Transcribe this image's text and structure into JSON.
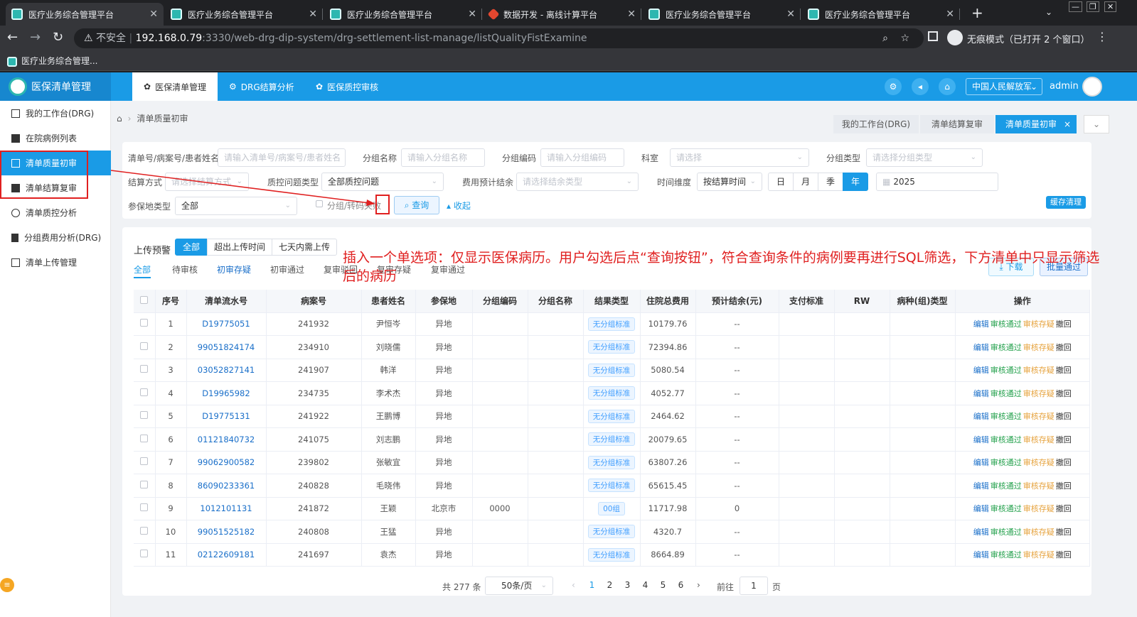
{
  "browser": {
    "tabs": [
      {
        "title": "医疗业务综合管理平台"
      },
      {
        "title": "医疗业务综合管理平台"
      },
      {
        "title": "医疗业务综合管理平台"
      },
      {
        "title": "数据开发 - 离线计算平台"
      },
      {
        "title": "医疗业务综合管理平台"
      },
      {
        "title": "医疗业务综合管理平台"
      }
    ],
    "new_tab": "+",
    "security": "不安全",
    "url_host": "192.168.0.79",
    "url_rest": ":3330/web-drg-dip-system/drg-settlement-list-manage/listQualityFistExamine",
    "incognito": "无痕模式（已打开 2 个窗口）",
    "bookmark": "医疗业务综合管理...",
    "window_controls": [
      "—",
      "❐",
      "✕"
    ]
  },
  "app": {
    "brand": "医保清单管理",
    "top_nav": [
      {
        "label": "医保清单管理"
      },
      {
        "label": "DRG结算分析"
      },
      {
        "label": "医保质控审核"
      }
    ],
    "hospital": "中国人民解放军",
    "user": "admin",
    "sidebar": [
      {
        "label": "我的工作台(DRG)"
      },
      {
        "label": "在院病例列表"
      },
      {
        "label": "清单质量初审"
      },
      {
        "label": "清单结算复审"
      },
      {
        "label": "清单质控分析"
      },
      {
        "label": "分组费用分析(DRG)"
      },
      {
        "label": "清单上传管理"
      }
    ],
    "breadcrumb": "清单质量初审",
    "page_tabs": [
      {
        "label": "我的工作台(DRG)"
      },
      {
        "label": "清单结算复审"
      },
      {
        "label": "清单质量初审"
      }
    ]
  },
  "filters": {
    "search_label": "清单号/病案号/患者姓名",
    "search_placeholder": "请输入清单号/病案号/患者姓名",
    "group_name_label": "分组名称",
    "group_name_placeholder": "请输入分组名称",
    "group_code_label": "分组编码",
    "group_code_placeholder": "请输入分组编码",
    "dept_label": "科室",
    "dept_placeholder": "请选择",
    "group_type_label": "分组类型",
    "group_type_placeholder": "请选择分组类型",
    "settle_label": "结算方式",
    "settle_placeholder": "请选择结算方式",
    "qc_type_label": "质控问题类型",
    "qc_type_value": "全部质控问题",
    "fee_label": "费用预计结余",
    "fee_placeholder": "请选择结余类型",
    "time_label": "时间维度",
    "time_value": "按结算时间",
    "period_buttons": [
      "日",
      "月",
      "季",
      "年"
    ],
    "year_value": "2025",
    "insured_label": "参保地类型",
    "insured_value": "全部",
    "transfer_label": "分组/转码失败",
    "query_button": "查询",
    "collapse_button": "收起",
    "cache_button": "缓存清理"
  },
  "annotation": "插入一个单选项：仅显示医保病历。用户勾选后点“查询按钮”，符合查询条件的病例要再进行SQL筛选，下方清单中只显示筛选后的病历",
  "list": {
    "warning_label": "上传预警",
    "warning_tabs": [
      "全部",
      "超出上传时间",
      "七天内需上传"
    ],
    "status_tabs": [
      "全部",
      "待审核",
      "初审存疑",
      "初审通过",
      "复审驳回",
      "复审存疑",
      "复审通过"
    ],
    "download_button": "下载",
    "batch_button": "批量通过",
    "columns": [
      "序号",
      "清单流水号",
      "病案号",
      "患者姓名",
      "参保地",
      "分组编码",
      "分组名称",
      "结果类型",
      "住院总费用",
      "预计结余(元)",
      "支付标准",
      "RW",
      "病种(组)类型",
      "操作"
    ],
    "actions": [
      "编辑",
      "审核通过",
      "审核存疑",
      "撤回"
    ],
    "rows": [
      {
        "no": "1",
        "serial": "D19775051",
        "case_no": "241932",
        "name": "尹恒岑",
        "insured": "异地",
        "code": "",
        "group": "",
        "result": "无分组标准",
        "cost": "10179.76",
        "balance": "--"
      },
      {
        "no": "2",
        "serial": "99051824174",
        "case_no": "234910",
        "name": "刘晓儒",
        "insured": "异地",
        "code": "",
        "group": "",
        "result": "无分组标准",
        "cost": "72394.86",
        "balance": "--"
      },
      {
        "no": "3",
        "serial": "03052827141",
        "case_no": "241907",
        "name": "韩洋",
        "insured": "异地",
        "code": "",
        "group": "",
        "result": "无分组标准",
        "cost": "5080.54",
        "balance": "--"
      },
      {
        "no": "4",
        "serial": "D19965982",
        "case_no": "234735",
        "name": "李术杰",
        "insured": "异地",
        "code": "",
        "group": "",
        "result": "无分组标准",
        "cost": "4052.77",
        "balance": "--"
      },
      {
        "no": "5",
        "serial": "D19775131",
        "case_no": "241922",
        "name": "王鹏博",
        "insured": "异地",
        "code": "",
        "group": "",
        "result": "无分组标准",
        "cost": "2464.62",
        "balance": "--"
      },
      {
        "no": "6",
        "serial": "01121840732",
        "case_no": "241075",
        "name": "刘志鹏",
        "insured": "异地",
        "code": "",
        "group": "",
        "result": "无分组标准",
        "cost": "20079.65",
        "balance": "--"
      },
      {
        "no": "7",
        "serial": "99062900582",
        "case_no": "239802",
        "name": "张敏宜",
        "insured": "异地",
        "code": "",
        "group": "",
        "result": "无分组标准",
        "cost": "63807.26",
        "balance": "--"
      },
      {
        "no": "8",
        "serial": "86090233361",
        "case_no": "240828",
        "name": "毛晓伟",
        "insured": "异地",
        "code": "",
        "group": "",
        "result": "无分组标准",
        "cost": "65615.45",
        "balance": "--"
      },
      {
        "no": "9",
        "serial": "1012101131",
        "case_no": "241872",
        "name": "王颖",
        "insured": "北京市",
        "code": "0000",
        "group": "",
        "result": "00组",
        "cost": "11717.98",
        "balance": "0"
      },
      {
        "no": "10",
        "serial": "99051525182",
        "case_no": "240808",
        "name": "王猛",
        "insured": "异地",
        "code": "",
        "group": "",
        "result": "无分组标准",
        "cost": "4320.7",
        "balance": "--"
      },
      {
        "no": "11",
        "serial": "02122609181",
        "case_no": "241697",
        "name": "袁杰",
        "insured": "异地",
        "code": "",
        "group": "",
        "result": "无分组标准",
        "cost": "8664.89",
        "balance": "--"
      }
    ]
  },
  "pagination": {
    "total": "共 277 条",
    "page_size": "50条/页",
    "pages": [
      "1",
      "2",
      "3",
      "4",
      "5",
      "6"
    ],
    "goto_label": "前往",
    "goto_value": "1",
    "page_suffix": "页"
  },
  "colors": {
    "accent": "#1a9be6",
    "annotation": "#e02020",
    "pass": "#22a04b",
    "doubt": "#e6a23c"
  }
}
